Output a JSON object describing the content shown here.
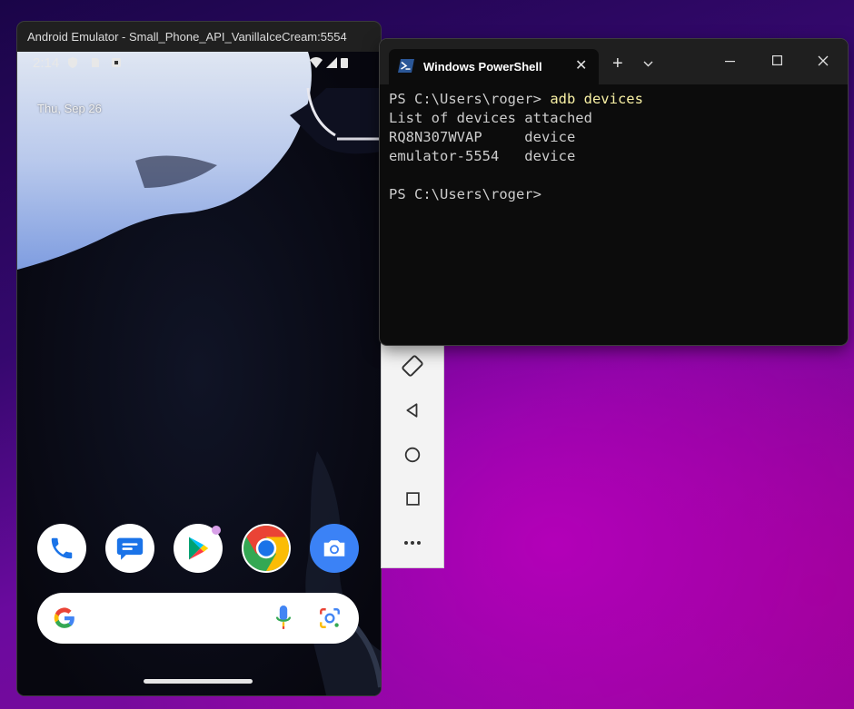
{
  "emulator": {
    "title": "Android Emulator - Small_Phone_API_VanillaIceCream:5554",
    "status_time": "2:14",
    "date": "Thu, Sep 26",
    "dock_apps": [
      {
        "name": "Phone",
        "icon": "phone-icon"
      },
      {
        "name": "Messages",
        "icon": "messages-icon"
      },
      {
        "name": "Play Store",
        "icon": "play-store-icon"
      },
      {
        "name": "Chrome",
        "icon": "chrome-icon"
      },
      {
        "name": "Camera",
        "icon": "camera-icon"
      }
    ],
    "sidebar": [
      {
        "name": "rotate",
        "icon": "rotate-icon"
      },
      {
        "name": "back",
        "icon": "back-icon"
      },
      {
        "name": "home",
        "icon": "home-icon"
      },
      {
        "name": "overview",
        "icon": "overview-icon"
      },
      {
        "name": "more",
        "icon": "more-icon"
      }
    ]
  },
  "terminal": {
    "tab_title": "Windows PowerShell",
    "prompt": "PS C:\\Users\\roger> ",
    "command": "adb devices",
    "lines": [
      "List of devices attached",
      "RQ8N307WVAP     device",
      "emulator-5554   device",
      ""
    ],
    "final_prompt": "PS C:\\Users\\roger>"
  },
  "colors": {
    "terminal_bg": "#0c0c0c",
    "command_yellow": "#f9f1a5",
    "powershell_blue": "#2b5797"
  }
}
